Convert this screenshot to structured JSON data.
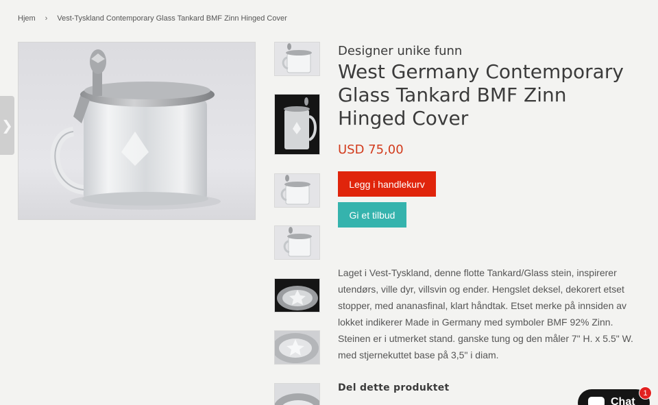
{
  "breadcrumb": {
    "home": "Hjem",
    "separator": "›",
    "current": "Vest-Tyskland Contemporary Glass Tankard BMF Zinn Hinged Cover"
  },
  "side_tab": {
    "icon": "chevron-right-icon",
    "glyph": "❯"
  },
  "product": {
    "vendor": "Designer unike funn",
    "title": "West Germany Contemporary Glass Tankard BMF Zinn Hinged Cover",
    "price": "USD 75,00",
    "add_to_cart_label": "Legg i handlekurv",
    "make_offer_label": "Gi et tilbud",
    "description": "Laget i Vest-Tyskland, denne flotte Tankard/Glass stein, inspirerer utendørs, ville dyr, villsvin og ender. Hengslet deksel, dekorert etset stopper, med ananasfinal, klart håndtak. Etset merke på innsiden av lokket indikerer Made in Germany med symboler BMF 92% Zinn. Steinen er i utmerket stand. ganske tung og den måler 7\" H. x 5.5\" W. med stjernekuttet base på 3,5\" i diam.",
    "share_heading": "Del dette produktet"
  },
  "thumbnails": [
    {
      "name": "thumbnail-1"
    },
    {
      "name": "thumbnail-2"
    },
    {
      "name": "thumbnail-3"
    },
    {
      "name": "thumbnail-4"
    },
    {
      "name": "thumbnail-5"
    },
    {
      "name": "thumbnail-6"
    },
    {
      "name": "thumbnail-7"
    }
  ],
  "chat": {
    "label": "Chat",
    "badge_count": "1",
    "icon": "chat-bubble-icon"
  },
  "colors": {
    "price": "#d23b1d",
    "cart_button": "#e0240b",
    "offer_button": "#35b3ad",
    "chat_bg": "#151515",
    "badge": "#e22120"
  }
}
